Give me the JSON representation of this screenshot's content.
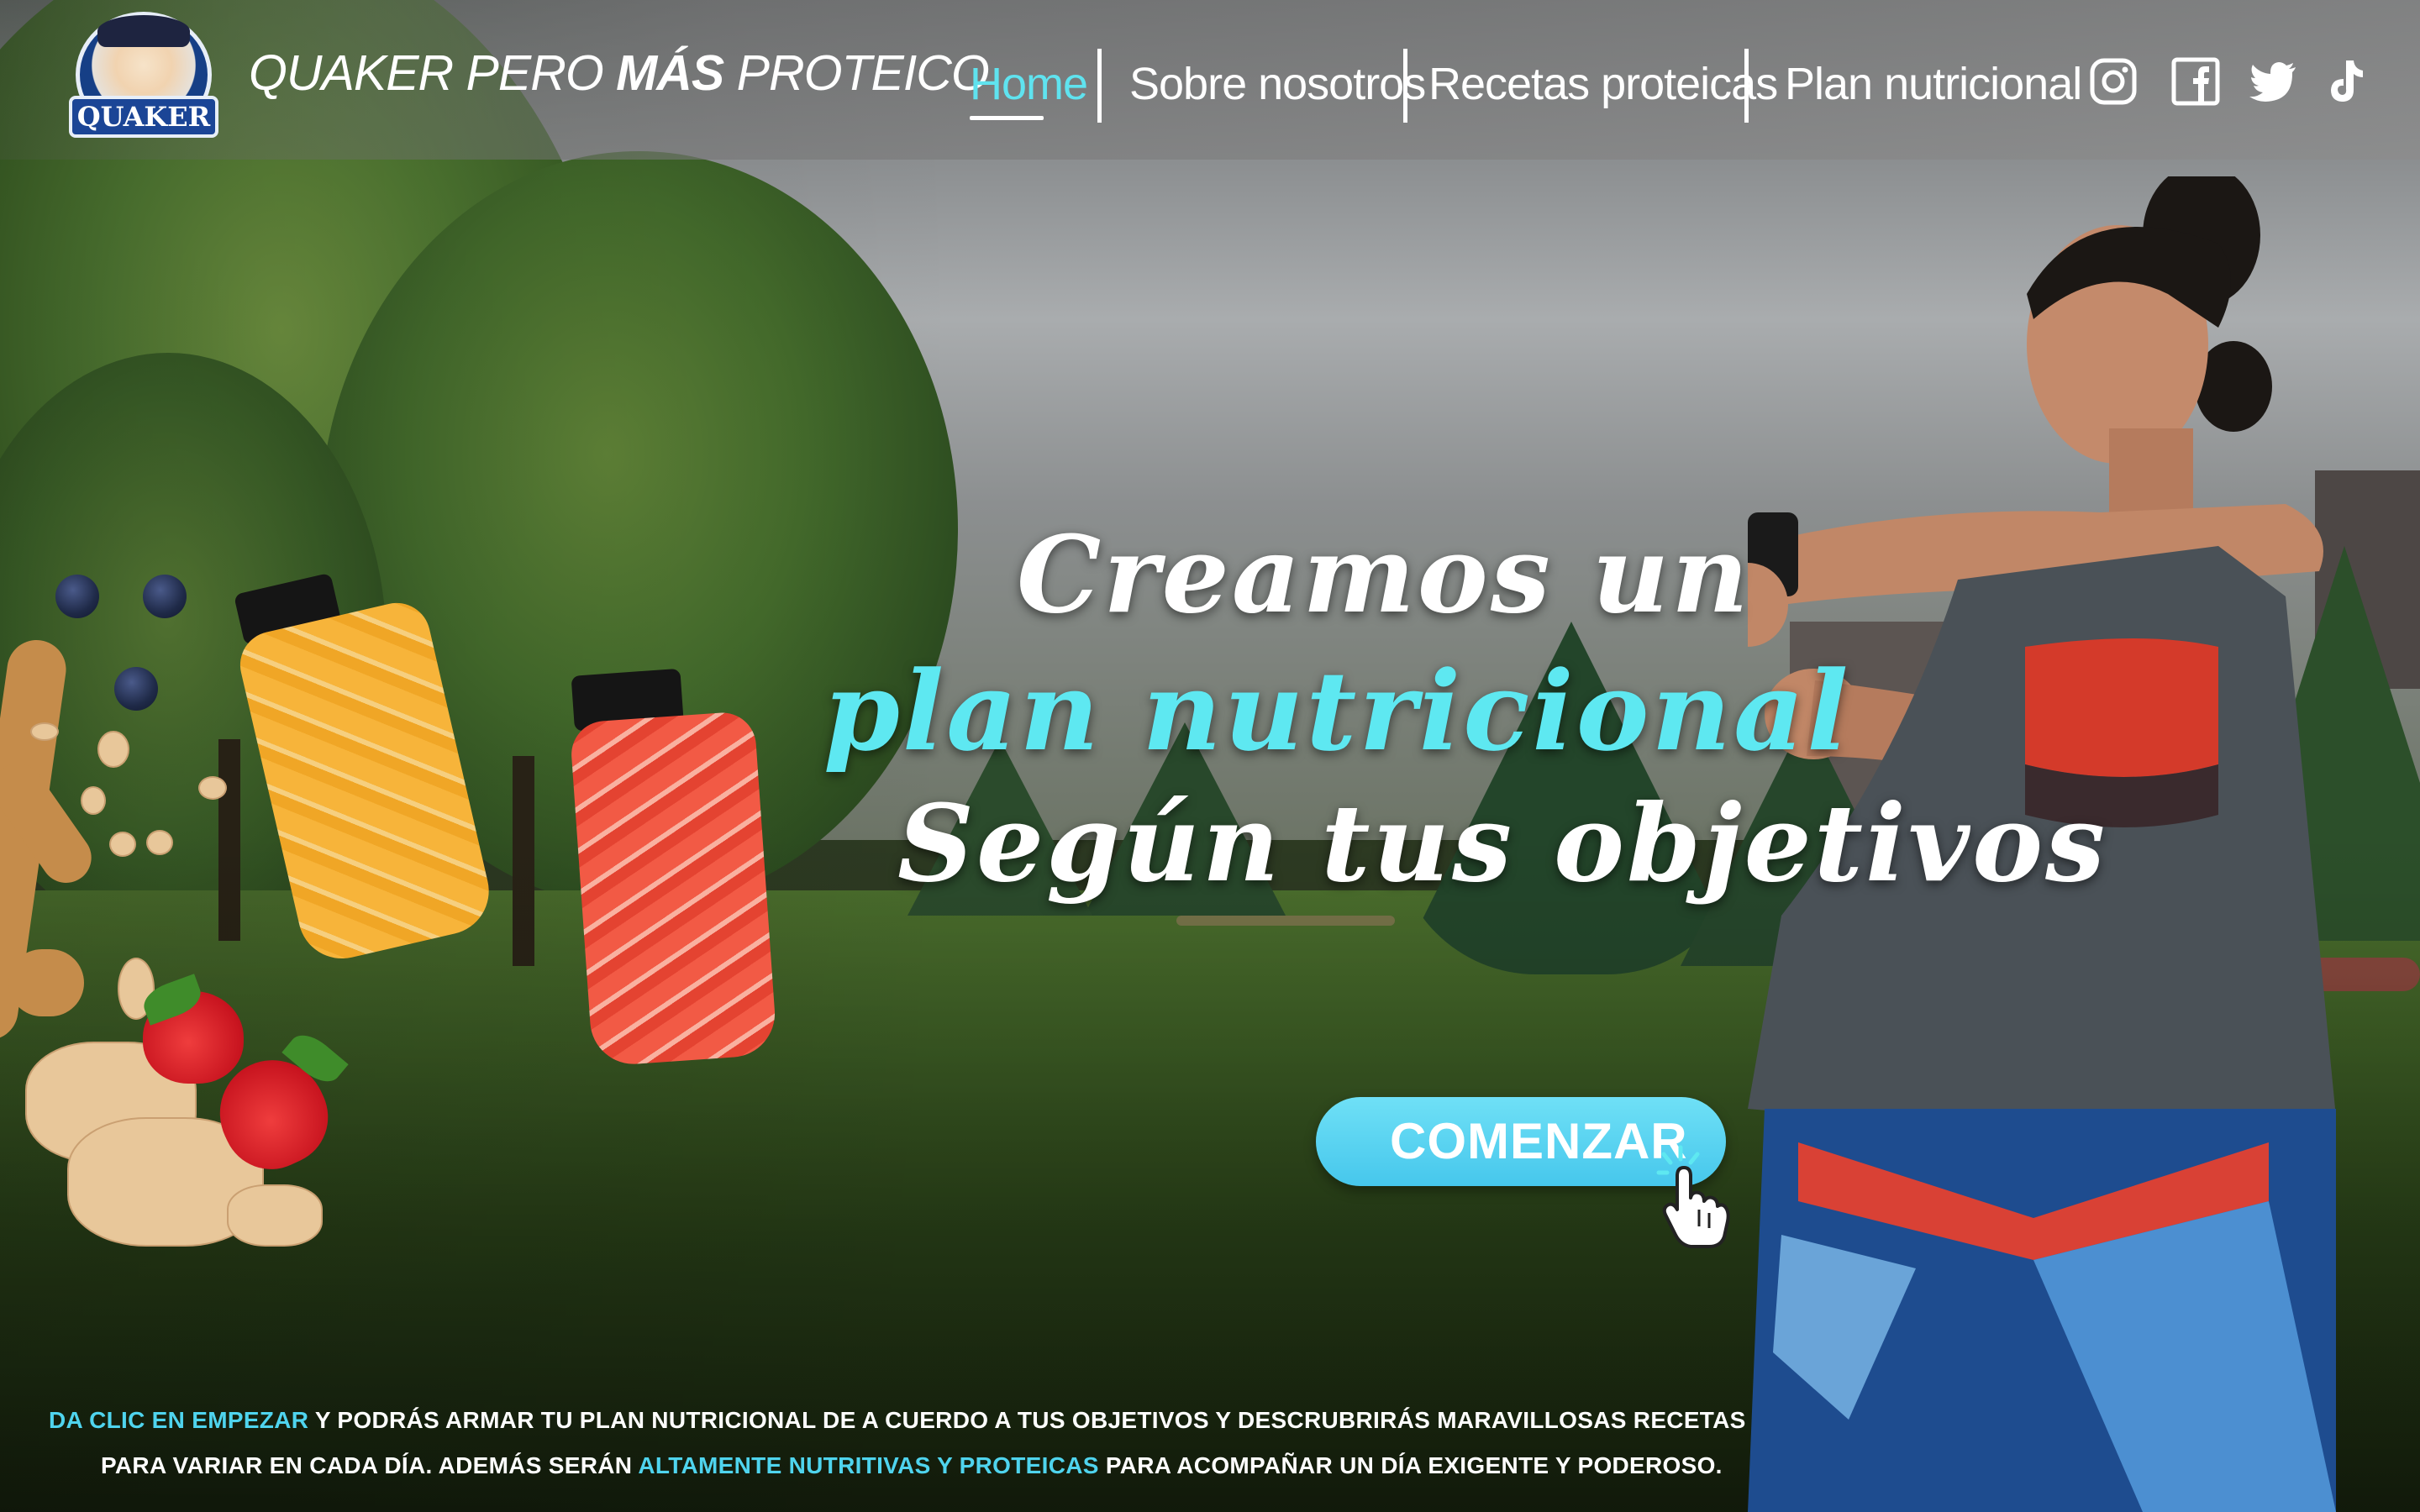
{
  "brand": {
    "logo_text": "QUAKER",
    "title_prefix": "QUAKER PERO ",
    "title_bold": "MÁS",
    "title_suffix": " PROTEICO"
  },
  "nav": {
    "items": [
      {
        "label": "Home",
        "active": true
      },
      {
        "label": "Sobre nosotros",
        "active": false
      },
      {
        "label": "Recetas proteicas",
        "active": false
      },
      {
        "label": "Plan nutricional",
        "active": false
      }
    ]
  },
  "social": [
    "instagram-icon",
    "facebook-icon",
    "twitter-icon",
    "tiktok-icon"
  ],
  "hero": {
    "line1": "Creamos un",
    "line2": "plan nutricional",
    "line3": "Según tus objetivos"
  },
  "cta": {
    "label": "COMENZAR"
  },
  "bottom": {
    "line1_highlight": "DA CLIC EN EMPEZAR",
    "line1_text": " Y PODRÁS ARMAR TU PLAN NUTRICIONAL DE A CUERDO A TUS OBJETIVOS Y DESCRUBRIRÁS MARAVILLOSAS RECETAS",
    "line2_text_a": "PARA VARIAR EN CADA DÍA. ADEMÁS SERÁN ",
    "line2_highlight": "ALTAMENTE NUTRITIVAS Y PROTEICAS",
    "line2_text_b": " PARA ACOMPAÑAR UN DÍA EXIGENTE Y PODEROSO."
  },
  "colors": {
    "accent": "#5ee8f1",
    "cta": "#4fcbed",
    "header_bg": "#8c8c8c",
    "text": "#ffffff"
  }
}
